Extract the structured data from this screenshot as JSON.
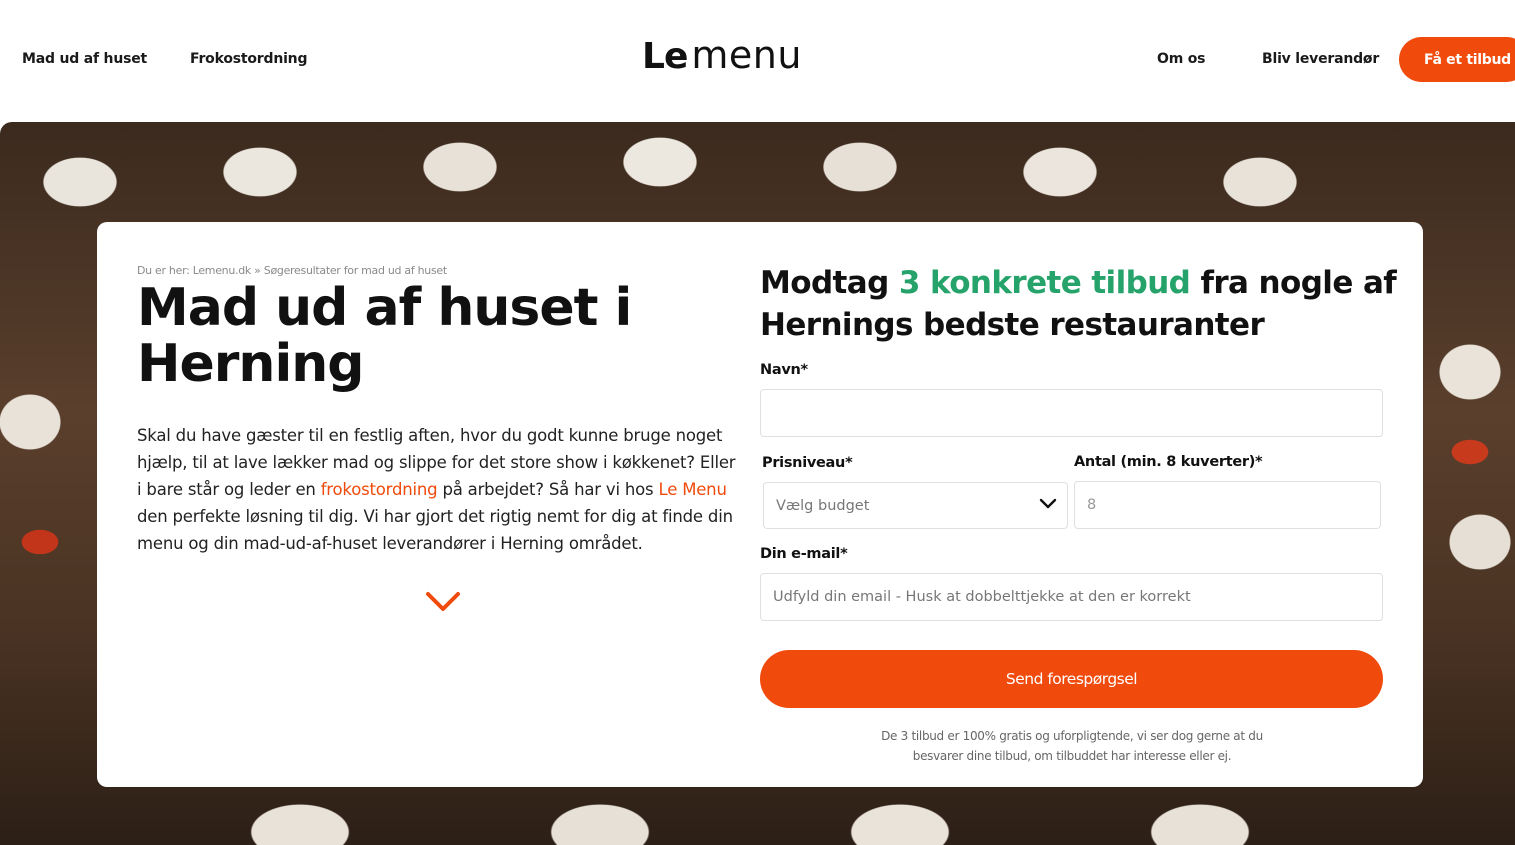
{
  "header": {
    "nav_left": [
      "Mad ud af huset",
      "Frokostordning"
    ],
    "logo": {
      "part1": "Le",
      "part2": "menu"
    },
    "nav_right": [
      "Om os",
      "Bliv leverandør"
    ],
    "cta_label": "Få et tilbud"
  },
  "hero": {
    "breadcrumb": "Du er her:  Lemenu.dk » Søgeresultater for mad ud af huset",
    "title": "Mad ud af huset i Herning",
    "intro": {
      "part1": "Skal du have gæster til en festlig aften, hvor du godt kunne bruge noget hjælp, til at lave lækker mad og slippe for det store show i køkkenet? Eller i bare står og leder en ",
      "link1": "frokostordning",
      "part2": " på arbejdet? Så har vi hos ",
      "link2": "Le Menu",
      "part3": " den perfekte løsning til dig. Vi har gjort det rigtig nemt for dig at finde din menu og din mad-ud-af-huset leverandører i Herning området."
    }
  },
  "form": {
    "heading": {
      "part1": "Modtag ",
      "accent": "3 konkrete tilbud",
      "part2": " fra nogle af Hernings bedste restauranter"
    },
    "name_label": "Navn*",
    "name_value": "",
    "price_label": "Prisniveau*",
    "price_selected": "Vælg budget",
    "count_label": "Antal (min. 8 kuverter)*",
    "count_placeholder": "8",
    "email_label": "Din e-mail*",
    "email_placeholder": "Udfyld din email - Husk at dobbelttjekke at den er korrekt",
    "submit_label": "Send forespørgsel",
    "disclaimer": "De 3 tilbud er 100% gratis og uforpligtende, vi ser dog gerne at du besvarer dine tilbud, om tilbuddet har interesse eller ej."
  },
  "colors": {
    "accent_orange": "#f04a0c",
    "accent_green": "#25a36a"
  },
  "icons": {
    "scroll_down": "chevron-down-icon",
    "select_arrow": "chevron-down-icon"
  }
}
